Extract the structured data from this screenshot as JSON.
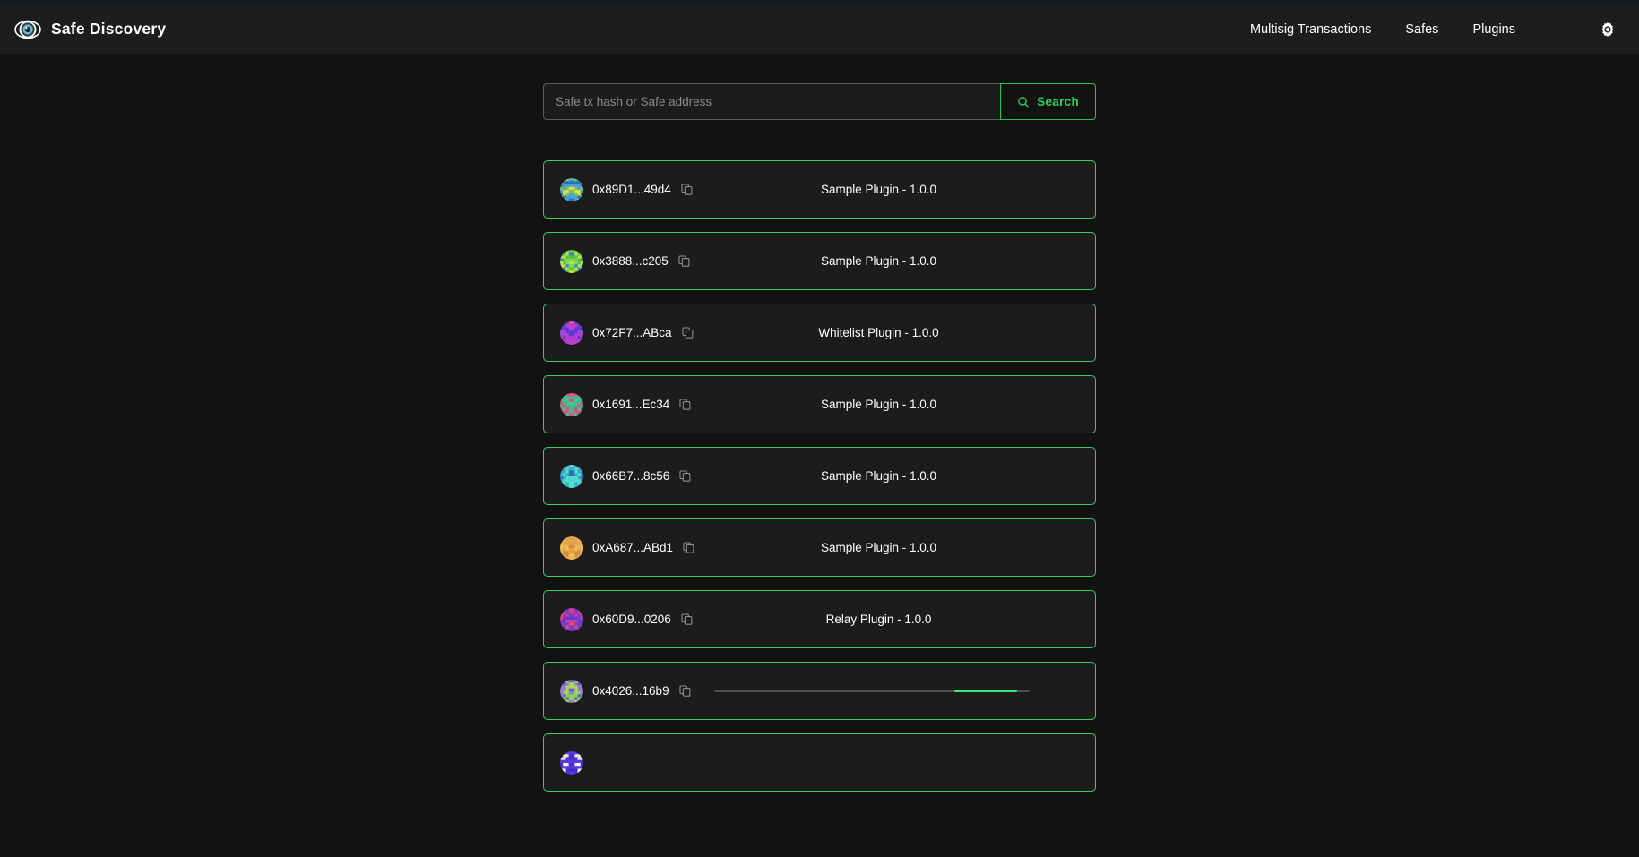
{
  "theme": {
    "background": "#121212",
    "appbar_background": "#1d1d1d",
    "top_strip": "#141a28",
    "accent_green": "#35cf63",
    "card_background": "#1c1c1c",
    "text_primary": "#ffffff",
    "placeholder": "#8b8b8b",
    "progress_track": "#4d4d4d",
    "progress_fill": "#3ee57f"
  },
  "header": {
    "logo_icon": "eye-icon",
    "title": "Safe Discovery",
    "nav": [
      {
        "label": "Multisig Transactions"
      },
      {
        "label": "Safes"
      },
      {
        "label": "Plugins"
      }
    ],
    "settings_icon": "gear-icon"
  },
  "search": {
    "placeholder": "Safe tx hash or Safe address",
    "value": "",
    "button_label": "Search",
    "button_icon": "search-icon"
  },
  "results": {
    "copy_icon": "copy-icon",
    "items": [
      {
        "address": "0x89D1...49d4",
        "plugin": "Sample Plugin - 1.0.0",
        "loading": false,
        "avatar_colors": [
          "#4aa3d8",
          "#d6e24a",
          "#2e6fb7",
          "#86c24a"
        ]
      },
      {
        "address": "0x3888...c205",
        "plugin": "Sample Plugin - 1.0.0",
        "loading": false,
        "avatar_colors": [
          "#5fc23a",
          "#b8e24a",
          "#3a7fd5",
          "#7ed957"
        ]
      },
      {
        "address": "0x72F7...ABca",
        "plugin": "Whitelist Plugin - 1.0.0",
        "loading": false,
        "avatar_colors": [
          "#c23ad0",
          "#e24aa8",
          "#5a3ad0",
          "#9b4ad9"
        ]
      },
      {
        "address": "0x1691...Ec34",
        "plugin": "Sample Plugin - 1.0.0",
        "loading": false,
        "avatar_colors": [
          "#4ab88a",
          "#e24a8a",
          "#3ad09b",
          "#d94a7e"
        ]
      },
      {
        "address": "0x66B7...8c56",
        "plugin": "Sample Plugin - 1.0.0",
        "loading": false,
        "avatar_colors": [
          "#3aa8d0",
          "#4ae2c8",
          "#2e6fb7",
          "#57d9c9"
        ]
      },
      {
        "address": "0xA687...ABd1",
        "plugin": "Sample Plugin - 1.0.0",
        "loading": false,
        "avatar_colors": [
          "#e2a24a",
          "#f0c04a",
          "#d98a3a",
          "#e8b85c"
        ]
      },
      {
        "address": "0x60D9...0206",
        "plugin": "Relay Plugin - 1.0.0",
        "loading": false,
        "avatar_colors": [
          "#7a3ad0",
          "#e24a6a",
          "#5a3ad9",
          "#d93a88"
        ]
      },
      {
        "address": "0x4026...16b9",
        "plugin": "",
        "loading": true,
        "progress_start_percent": 76,
        "progress_end_percent": 96,
        "avatar_colors": [
          "#9b7ad0",
          "#8ad94a",
          "#6a5ad9",
          "#a8d957"
        ]
      },
      {
        "address": "",
        "plugin": "",
        "loading": false,
        "partial": true,
        "avatar_colors": [
          "#5a3ad9",
          "#ffffff",
          "#4a2ad0",
          "#e8e8e8"
        ]
      }
    ]
  }
}
